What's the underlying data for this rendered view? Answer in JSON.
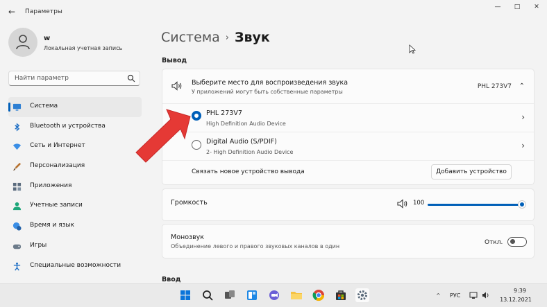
{
  "window": {
    "title": "Параметры",
    "back_glyph": "←",
    "minimize": "—",
    "maximize": "□",
    "close": "✕"
  },
  "profile": {
    "name": "w",
    "account_type": "Локальная учетная запись"
  },
  "search": {
    "placeholder": "Найти параметр"
  },
  "sidebar": {
    "items": [
      {
        "label": "Система",
        "icon": "monitor-icon",
        "active": true
      },
      {
        "label": "Bluetooth и устройства",
        "icon": "bluetooth-icon"
      },
      {
        "label": "Сеть и Интернет",
        "icon": "wifi-icon"
      },
      {
        "label": "Персонализация",
        "icon": "brush-icon"
      },
      {
        "label": "Приложения",
        "icon": "apps-icon"
      },
      {
        "label": "Учетные записи",
        "icon": "person-icon"
      },
      {
        "label": "Время и язык",
        "icon": "globe-clock-icon"
      },
      {
        "label": "Игры",
        "icon": "gamepad-icon"
      },
      {
        "label": "Специальные возможности",
        "icon": "accessibility-icon"
      }
    ]
  },
  "breadcrumb": {
    "parent": "Система",
    "separator": "›",
    "current": "Звук"
  },
  "output": {
    "section_label": "Вывод",
    "header_title": "Выберите место для воспроизведения звука",
    "header_subtitle": "У приложений могут быть собственные параметры",
    "selected_device": "PHL 273V7",
    "devices": [
      {
        "name": "PHL 273V7",
        "description": "High Definition Audio Device",
        "checked": true
      },
      {
        "name": "Digital Audio (S/PDIF)",
        "description": "2- High Definition Audio Device",
        "checked": false
      }
    ],
    "pair_text": "Связать новое устройство вывода",
    "add_button": "Добавить устройство"
  },
  "volume": {
    "label": "Громкость",
    "value": "100",
    "level": 1.0
  },
  "mono": {
    "title": "Монозвук",
    "subtitle": "Объединение левого и правого звуковых каналов в один",
    "state": "Откл."
  },
  "input": {
    "section_label": "Ввод"
  },
  "taskbar": {
    "lang": "РУС",
    "time": "9:39",
    "date": "13.12.2021",
    "tray_up": "^"
  },
  "colors": {
    "accent": "#005fb8",
    "arrow": "#e53935"
  }
}
